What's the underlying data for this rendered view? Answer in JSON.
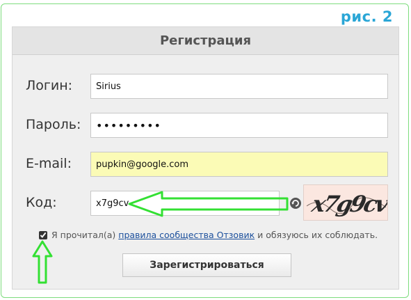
{
  "figure_label": "рис. 2",
  "form": {
    "title": "Регистрация",
    "login": {
      "label": "Логин:",
      "value": "Sirius"
    },
    "password": {
      "label": "Пароль:",
      "value": "•••••••••"
    },
    "email": {
      "label": "E-mail:",
      "value": "pupkin@google.com"
    },
    "code": {
      "label": "Код:",
      "value": "x7g9cv",
      "captcha_text": "x7g9cv"
    },
    "terms": {
      "checked": true,
      "prefix": "Я прочитал(а)",
      "link": "правила сообщества Отзовик",
      "suffix": "и обязуюсь их соблюдать."
    },
    "submit_label": "Зарегистрироваться"
  },
  "colors": {
    "frame_border": "#7ddc7d",
    "figure_label": "#2aa6d6",
    "annotation_arrow": "#33e033",
    "autofill_bg": "#fbfbb6",
    "link": "#1b4f9c"
  },
  "icons": [
    "refresh-icon",
    "arrow-left-icon",
    "arrow-up-icon"
  ]
}
